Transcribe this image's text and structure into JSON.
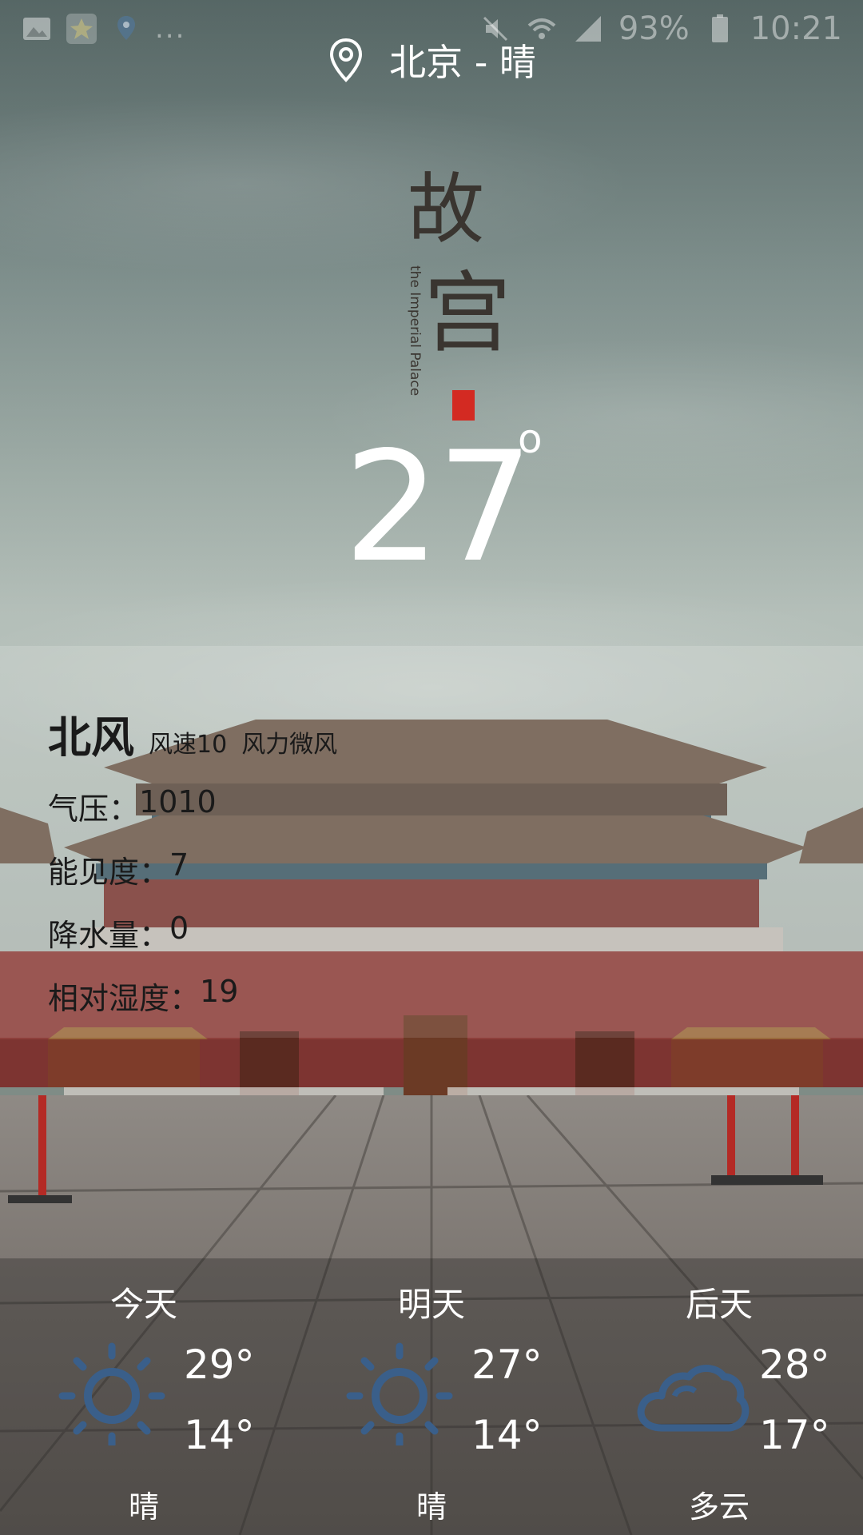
{
  "status_bar": {
    "battery": "93%",
    "time": "10:21",
    "notification_icons": [
      "image-icon",
      "star-icon",
      "location-icon"
    ],
    "overflow": "..."
  },
  "location": {
    "text": "北京 - 晴",
    "icon": "map-pin-icon"
  },
  "logo": {
    "title": "故宫",
    "subtitle": "the Imperial Palace"
  },
  "current": {
    "temperature": "27",
    "degree_symbol": "°"
  },
  "details": {
    "wind_direction": "北风",
    "wind_speed": "风速10",
    "wind_force": "风力微风",
    "pressure_label": "气压：",
    "pressure_value": "1010",
    "visibility_label": "能见度：",
    "visibility_value": "7",
    "precip_label": "降水量：",
    "precip_value": "0",
    "humidity_label": "相对湿度：",
    "humidity_value": "19"
  },
  "forecast": [
    {
      "day": "今天",
      "high": "29°",
      "low": "14°",
      "condition": "晴",
      "icon": "sun-icon"
    },
    {
      "day": "明天",
      "high": "27°",
      "low": "14°",
      "condition": "晴",
      "icon": "sun-icon"
    },
    {
      "day": "后天",
      "high": "28°",
      "low": "17°",
      "condition": "多云",
      "icon": "cloud-icon"
    }
  ],
  "colors": {
    "icon_blue": "#3a5f8a",
    "panel_text": "#1a1a1a"
  }
}
